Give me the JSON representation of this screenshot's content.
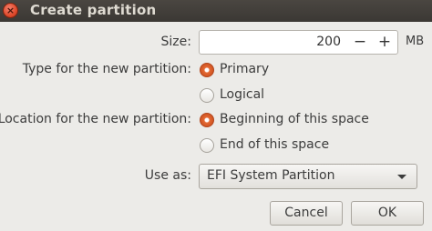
{
  "window": {
    "title": "Create partition",
    "close_symbol": "×"
  },
  "size": {
    "label": "Size:",
    "value": "200",
    "minus": "−",
    "plus": "+",
    "unit": "MB"
  },
  "type": {
    "label": "Type for the new partition:",
    "options": [
      {
        "label": "Primary",
        "checked": true
      },
      {
        "label": "Logical",
        "checked": false
      }
    ]
  },
  "location": {
    "label": "Location for the new partition:",
    "options": [
      {
        "label": "Beginning of this space",
        "checked": true
      },
      {
        "label": "End of this space",
        "checked": false
      }
    ]
  },
  "use_as": {
    "label": "Use as:",
    "selected": "EFI System Partition",
    "icon": "chevron-down-icon"
  },
  "buttons": {
    "cancel": "Cancel",
    "ok": "OK"
  },
  "colors": {
    "accent": "#e05a2a",
    "titlebar": "#3f3b37",
    "dialog_bg": "#ecebe8"
  }
}
